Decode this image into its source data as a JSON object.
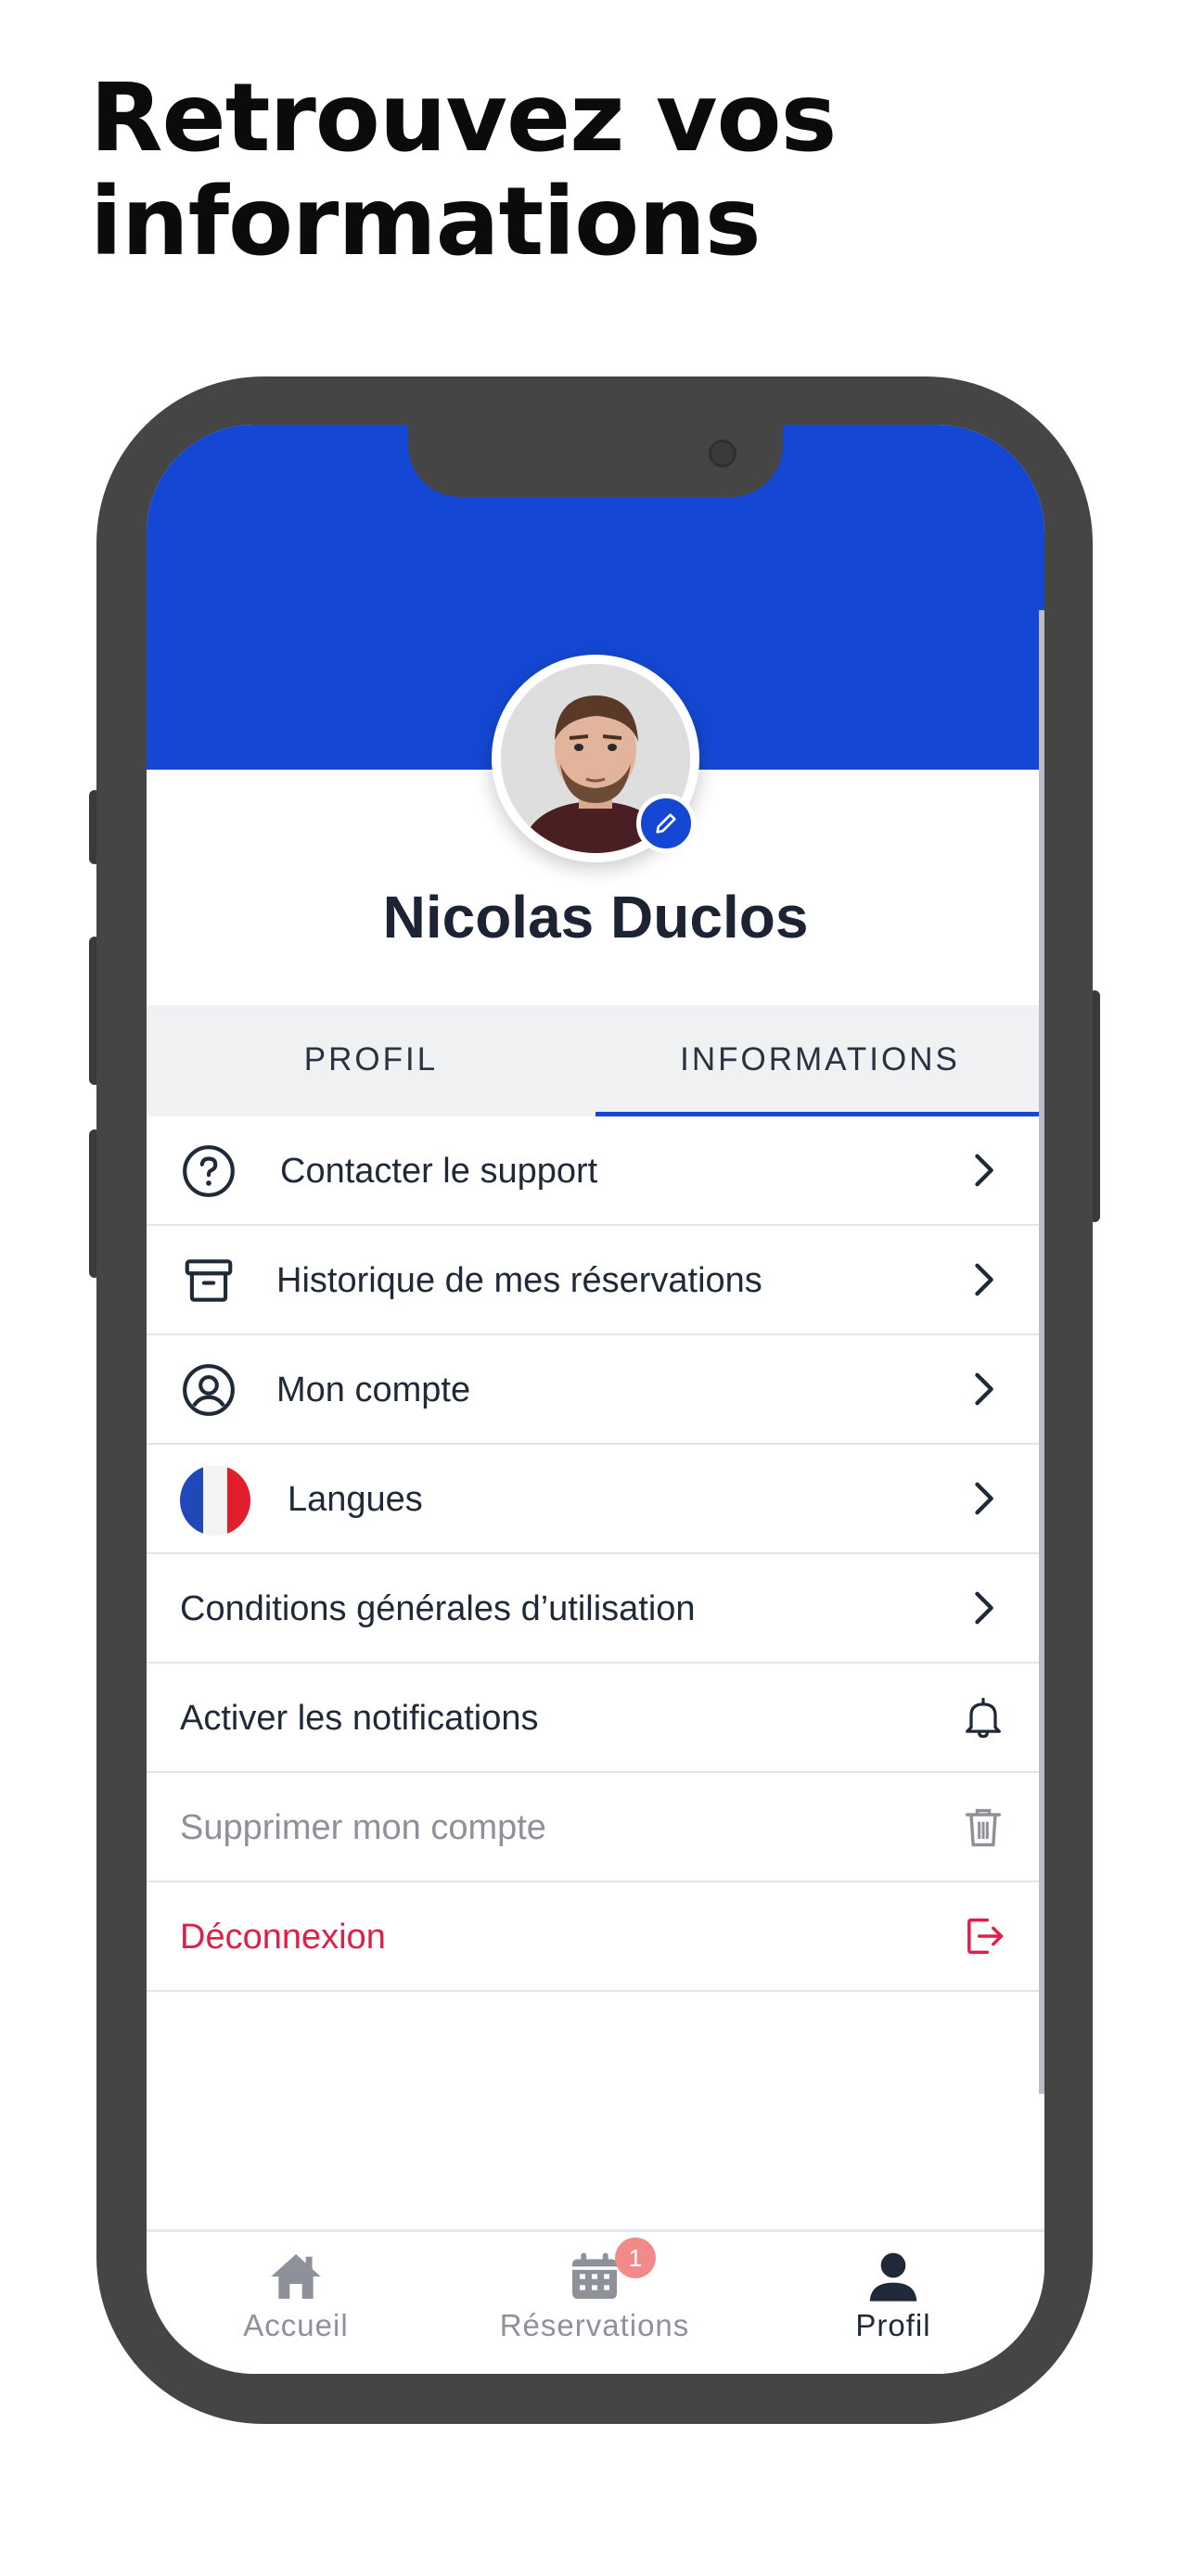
{
  "headline": {
    "line1": "Retrouvez vos",
    "line2": "informations"
  },
  "profile": {
    "name": "Nicolas Duclos"
  },
  "tabs": [
    {
      "label": "PROFIL",
      "active": false
    },
    {
      "label": "INFORMATIONS",
      "active": true
    }
  ],
  "menu": {
    "support": "Contacter le support",
    "history": "Historique de mes réservations",
    "account": "Mon compte",
    "languages": "Langues",
    "terms": "Conditions générales d’utilisation",
    "notifications": "Activer les notifications",
    "delete_account": "Supprimer mon compte",
    "logout": "Déconnexion"
  },
  "bottom_nav": {
    "home": "Accueil",
    "reservations": "Réservations",
    "reservations_badge": "1",
    "profile": "Profil",
    "active": "profile"
  },
  "colors": {
    "primary": "#1448d4",
    "danger": "#e11d48",
    "muted": "#8e9199",
    "text": "#1f2937",
    "badge": "#f28a8a"
  }
}
